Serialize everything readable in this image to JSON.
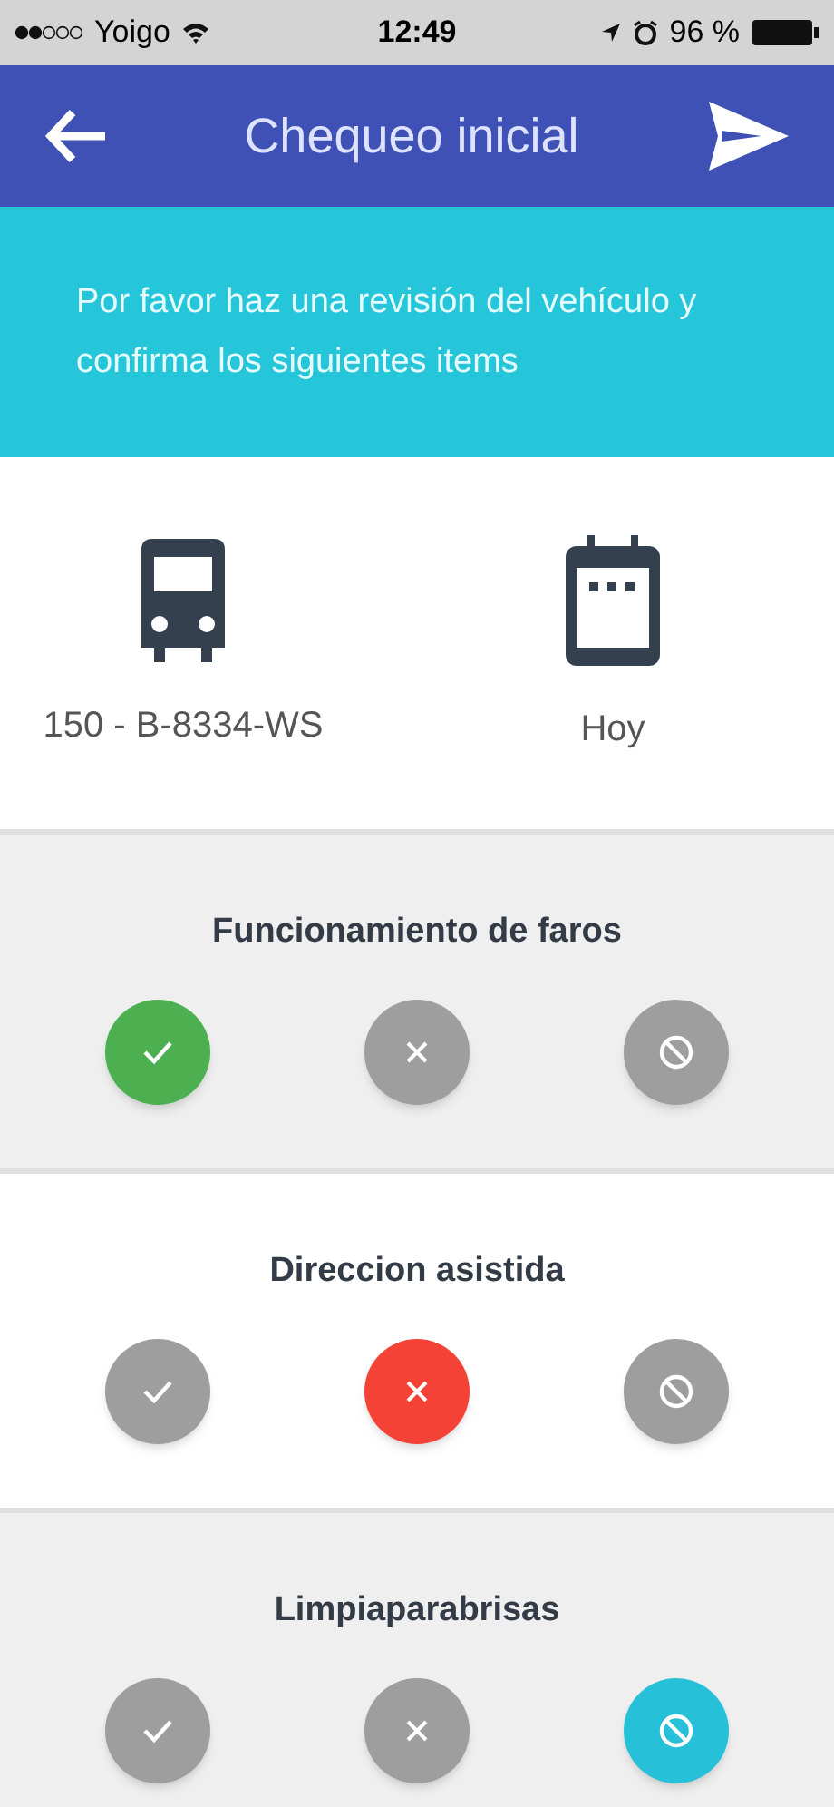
{
  "status_bar": {
    "carrier": "Yoigo",
    "time": "12:49",
    "battery": "96 %"
  },
  "header": {
    "title": "Chequeo inicial"
  },
  "banner": {
    "text": "Por favor haz una revisión del vehículo y confirma los siguientes items"
  },
  "summary": {
    "vehicle": "150 - B-8334-WS",
    "date": "Hoy"
  },
  "checks": [
    {
      "title": "Funcionamiento de faros",
      "options": [
        {
          "kind": "ok",
          "selected": true
        },
        {
          "kind": "fail",
          "selected": false
        },
        {
          "kind": "na",
          "selected": false
        }
      ]
    },
    {
      "title": "Direccion asistida",
      "options": [
        {
          "kind": "ok",
          "selected": false
        },
        {
          "kind": "fail",
          "selected": true
        },
        {
          "kind": "na",
          "selected": false
        }
      ]
    },
    {
      "title": "Limpiaparabrisas",
      "options": [
        {
          "kind": "ok",
          "selected": false
        },
        {
          "kind": "fail",
          "selected": false
        },
        {
          "kind": "na",
          "selected": true
        }
      ]
    }
  ]
}
